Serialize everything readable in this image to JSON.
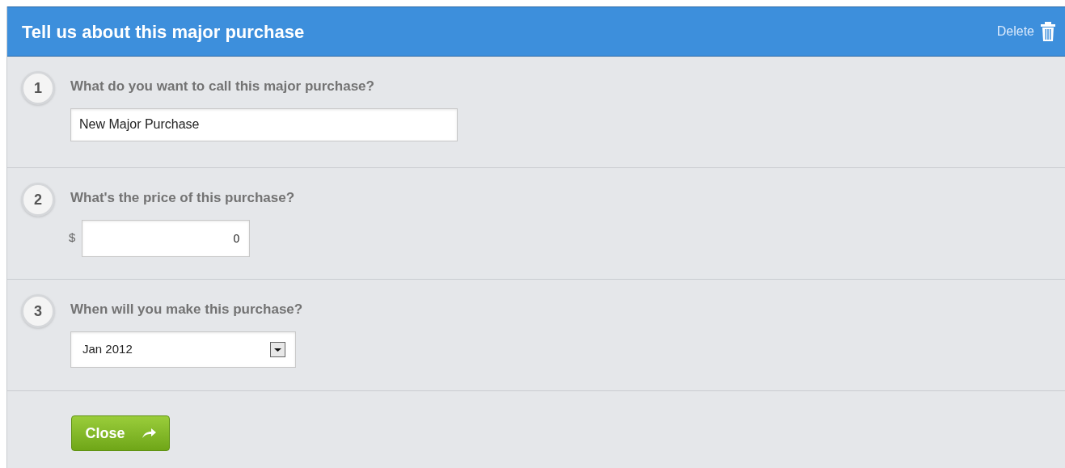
{
  "header": {
    "title": "Tell us about this major purchase",
    "delete_label": "Delete"
  },
  "steps": [
    {
      "kind": "text",
      "number": "1",
      "question": "What do you want to call this major purchase?",
      "value": "New Major Purchase"
    },
    {
      "kind": "currency",
      "number": "2",
      "question": "What's the price of this purchase?",
      "prefix": "$",
      "value": "0"
    },
    {
      "kind": "select",
      "number": "3",
      "question": "When will you make this purchase?",
      "value": "Jan 2012"
    }
  ],
  "close_button": "Close"
}
